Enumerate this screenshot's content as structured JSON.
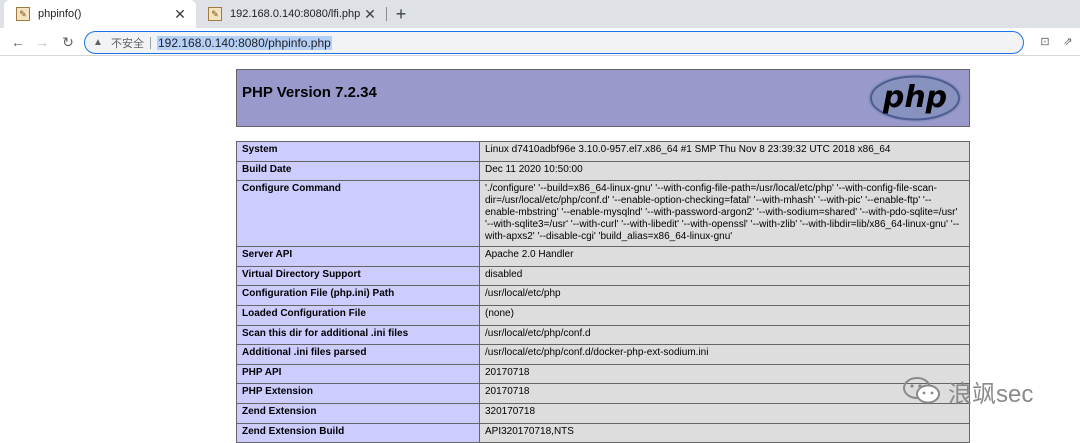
{
  "browser": {
    "tabs": [
      {
        "title": "phpinfo()",
        "active": true
      },
      {
        "title": "192.168.0.140:8080/lfi.php",
        "active": false
      }
    ],
    "address": {
      "security_text": "不安全",
      "url": "192.168.0.140:8080/phpinfo.php"
    }
  },
  "page": {
    "header_title": "PHP Version 7.2.34",
    "logo_text": "php",
    "rows": [
      {
        "key": "System",
        "value": "Linux d7410adbf96e 3.10.0-957.el7.x86_64 #1 SMP Thu Nov 8 23:39:32 UTC 2018 x86_64"
      },
      {
        "key": "Build Date",
        "value": "Dec 11 2020 10:50:00"
      },
      {
        "key": "Configure Command",
        "value": "'./configure' '--build=x86_64-linux-gnu' '--with-config-file-path=/usr/local/etc/php' '--with-config-file-scan-dir=/usr/local/etc/php/conf.d' '--enable-option-checking=fatal' '--with-mhash' '--with-pic' '--enable-ftp' '--enable-mbstring' '--enable-mysqlnd' '--with-password-argon2' '--with-sodium=shared' '--with-pdo-sqlite=/usr' '--with-sqlite3=/usr' '--with-curl' '--with-libedit' '--with-openssl' '--with-zlib' '--with-libdir=lib/x86_64-linux-gnu' '--with-apxs2' '--disable-cgi' 'build_alias=x86_64-linux-gnu'"
      },
      {
        "key": "Server API",
        "value": "Apache 2.0 Handler"
      },
      {
        "key": "Virtual Directory Support",
        "value": "disabled"
      },
      {
        "key": "Configuration File (php.ini) Path",
        "value": "/usr/local/etc/php"
      },
      {
        "key": "Loaded Configuration File",
        "value": "(none)"
      },
      {
        "key": "Scan this dir for additional .ini files",
        "value": "/usr/local/etc/php/conf.d"
      },
      {
        "key": "Additional .ini files parsed",
        "value": "/usr/local/etc/php/conf.d/docker-php-ext-sodium.ini"
      },
      {
        "key": "PHP API",
        "value": "20170718"
      },
      {
        "key": "PHP Extension",
        "value": "20170718"
      },
      {
        "key": "Zend Extension",
        "value": "320170718"
      },
      {
        "key": "Zend Extension Build",
        "value": "API320170718,NTS"
      }
    ]
  },
  "watermark": {
    "text": "浪飒sec"
  },
  "colors": {
    "header_bg": "#9999cc",
    "key_bg": "#ccccff",
    "value_bg": "#dddddd"
  }
}
